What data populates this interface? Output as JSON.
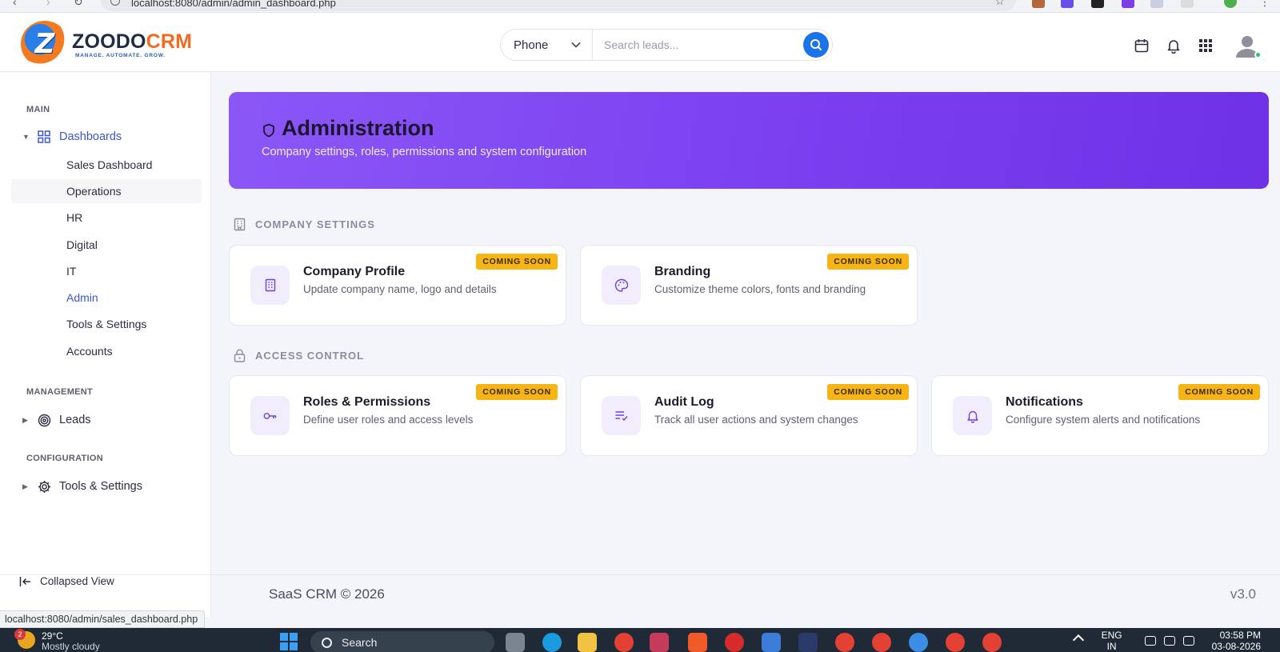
{
  "browser": {
    "url": "localhost:8080/admin/admin_dashboard.php",
    "status_url": "localhost:8080/admin/sales_dashboard.php"
  },
  "brand": {
    "name_part1": "ZOODO",
    "name_part2": "CRM",
    "tagline": "MANAGE. AUTOMATE. GROW.",
    "mark_letter": "Z",
    "colors": {
      "primary": "#1f2a44",
      "accent": "#f36b21",
      "blue": "#2a7ee8"
    }
  },
  "search": {
    "selected_field": "Phone",
    "placeholder": "Search leads..."
  },
  "sidebar": {
    "sections": [
      {
        "title": "MAIN"
      },
      {
        "title": "MANAGEMENT"
      },
      {
        "title": "CONFIGURATION"
      }
    ],
    "dashboards": {
      "label": "Dashboards",
      "icon": "grid-icon",
      "children": [
        {
          "label": "Sales Dashboard"
        },
        {
          "label": "Operations"
        },
        {
          "label": "HR"
        },
        {
          "label": "Digital"
        },
        {
          "label": "IT"
        },
        {
          "label": "Admin"
        },
        {
          "label": "Tools & Settings"
        },
        {
          "label": "Accounts"
        }
      ]
    },
    "leads": {
      "label": "Leads",
      "icon": "target-icon"
    },
    "tools": {
      "label": "Tools & Settings",
      "icon": "gear-icon"
    },
    "collapse_label": "Collapsed View"
  },
  "hero": {
    "title": "Administration",
    "subtitle": "Company settings, roles, permissions and system configuration",
    "gradient": [
      "#8b57f6",
      "#6f31e6"
    ]
  },
  "sections": {
    "company": {
      "title": "COMPANY SETTINGS",
      "cards": [
        {
          "title": "Company Profile",
          "desc": "Update company name, logo and details",
          "badge": "COMING SOON",
          "icon": "building-icon"
        },
        {
          "title": "Branding",
          "desc": "Customize theme colors, fonts and branding",
          "badge": "COMING SOON",
          "icon": "palette-icon"
        }
      ]
    },
    "access": {
      "title": "ACCESS CONTROL",
      "cards": [
        {
          "title": "Roles & Permissions",
          "desc": "Define user roles and access levels",
          "badge": "COMING SOON",
          "icon": "key-icon"
        },
        {
          "title": "Audit Log",
          "desc": "Track all user actions and system changes",
          "badge": "COMING SOON",
          "icon": "list-check-icon"
        },
        {
          "title": "Notifications",
          "desc": "Configure system alerts and notifications",
          "badge": "COMING SOON",
          "icon": "bell-icon"
        }
      ]
    }
  },
  "footer": {
    "copyright": "SaaS CRM © 2026",
    "version": "v3.0"
  },
  "taskbar": {
    "weather_temp": "29°C",
    "weather_cond": "Mostly cloudy",
    "weather_badge": "2",
    "search_label": "Search",
    "lang_top": "ENG",
    "lang_bottom": "IN",
    "time": "03:58 PM",
    "date": "03-08-2026"
  }
}
